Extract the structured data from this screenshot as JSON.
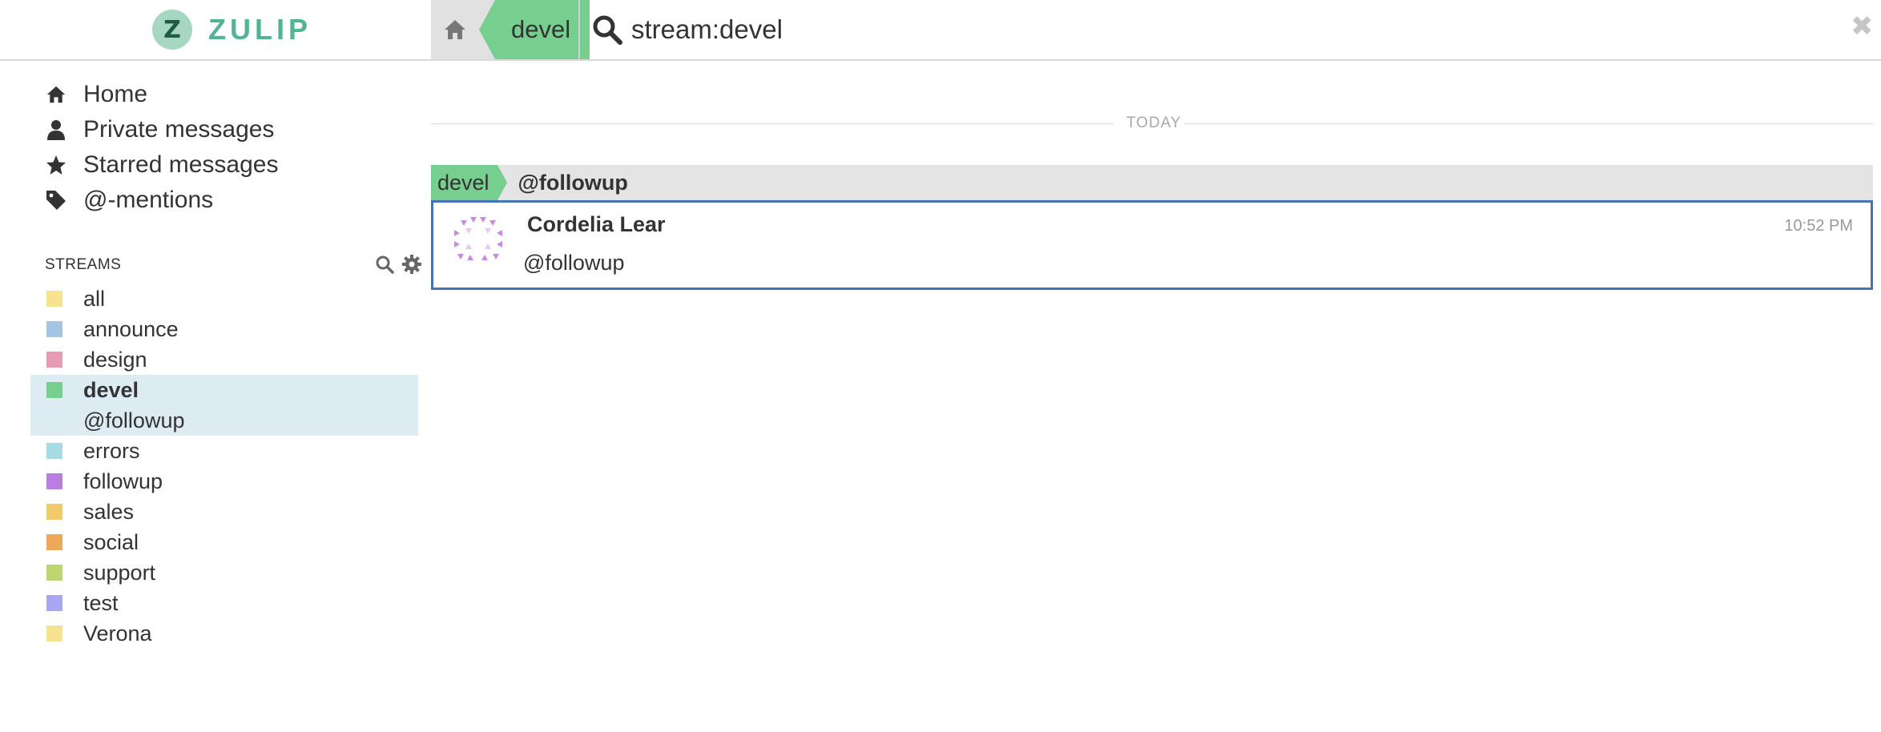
{
  "brand": {
    "name": "ZULIP",
    "logo_letter": "Z"
  },
  "header": {
    "home_icon": "home-icon",
    "stream_crumb": "devel",
    "search_query": "stream:devel",
    "clear_icon": "close-icon"
  },
  "global_filters": [
    {
      "label": "Home",
      "icon": "home-icon"
    },
    {
      "label": "Private messages",
      "icon": "user-icon"
    },
    {
      "label": "Starred messages",
      "icon": "star-icon"
    },
    {
      "label": "@-mentions",
      "icon": "tag-icon"
    }
  ],
  "streams_header": {
    "title": "STREAMS",
    "search_icon": "search-icon",
    "settings_icon": "gear-icon"
  },
  "streams": [
    {
      "name": "all",
      "color": "#f7e38f"
    },
    {
      "name": "announce",
      "color": "#a4c4e4"
    },
    {
      "name": "design",
      "color": "#e59cb4"
    },
    {
      "name": "devel",
      "color": "#76ce8f",
      "active": true,
      "topic": "@followup"
    },
    {
      "name": "errors",
      "color": "#a8dbe3"
    },
    {
      "name": "followup",
      "color": "#b97fe0"
    },
    {
      "name": "sales",
      "color": "#f3ca6b"
    },
    {
      "name": "social",
      "color": "#eea85a"
    },
    {
      "name": "support",
      "color": "#bed66f"
    },
    {
      "name": "test",
      "color": "#a8a7f2"
    },
    {
      "name": "Verona",
      "color": "#f7e38f"
    }
  ],
  "main": {
    "date_divider": "TODAY",
    "recipient": {
      "stream": "devel",
      "topic": "@followup",
      "color": "#76ce8f"
    },
    "message": {
      "sender": "Cordelia Lear",
      "time": "10:52 PM",
      "content": "@followup"
    }
  },
  "colors": {
    "accent": "#51b494",
    "selected_border": "#4474b4",
    "active_stream_bg": "#ddebf3"
  }
}
